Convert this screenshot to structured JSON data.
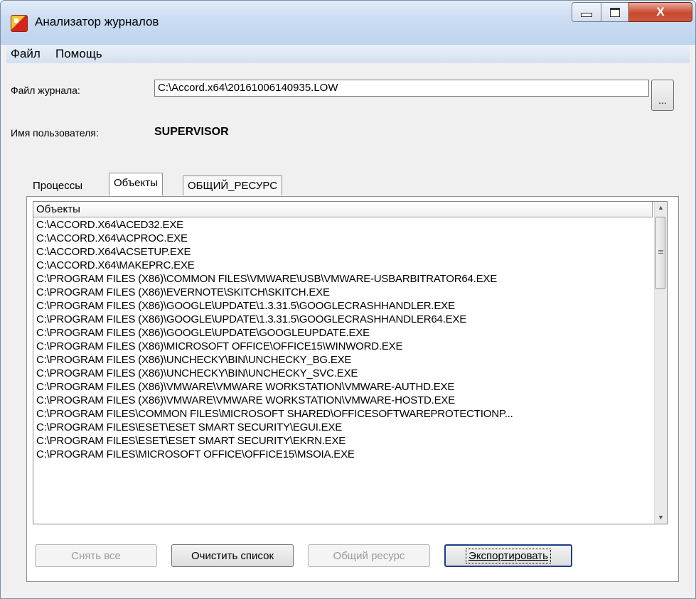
{
  "window": {
    "title": "Анализатор журналов",
    "close_glyph": "X"
  },
  "menu": {
    "items": [
      "Файл",
      "Помощь"
    ]
  },
  "form": {
    "log_file_label": "Файл журнала:",
    "log_file_value": "C:\\Accord.x64\\20161006140935.LOW",
    "browse_label": "...",
    "user_label": "Имя пользователя:",
    "user_value": "SUPERVISOR"
  },
  "tabs": [
    "Процессы",
    "Объекты",
    "ОБЩИЙ_РЕСУРС"
  ],
  "active_tab": "Объекты",
  "list": {
    "column_header": "Объекты",
    "rows": [
      "C:\\ACCORD.X64\\ACED32.EXE",
      "C:\\ACCORD.X64\\ACPROC.EXE",
      "C:\\ACCORD.X64\\ACSETUP.EXE",
      "C:\\ACCORD.X64\\MAKEPRC.EXE",
      "C:\\PROGRAM FILES (X86)\\COMMON FILES\\VMWARE\\USB\\VMWARE-USBARBITRATOR64.EXE",
      "C:\\PROGRAM FILES (X86)\\EVERNOTE\\SKITCH\\SKITCH.EXE",
      "C:\\PROGRAM FILES (X86)\\GOOGLE\\UPDATE\\1.3.31.5\\GOOGLECRASHHANDLER.EXE",
      "C:\\PROGRAM FILES (X86)\\GOOGLE\\UPDATE\\1.3.31.5\\GOOGLECRASHHANDLER64.EXE",
      "C:\\PROGRAM FILES (X86)\\GOOGLE\\UPDATE\\GOOGLEUPDATE.EXE",
      "C:\\PROGRAM FILES (X86)\\MICROSOFT OFFICE\\OFFICE15\\WINWORD.EXE",
      "C:\\PROGRAM FILES (X86)\\UNCHECKY\\BIN\\UNCHECKY_BG.EXE",
      "C:\\PROGRAM FILES (X86)\\UNCHECKY\\BIN\\UNCHECKY_SVC.EXE",
      "C:\\PROGRAM FILES (X86)\\VMWARE\\VMWARE WORKSTATION\\VMWARE-AUTHD.EXE",
      "C:\\PROGRAM FILES (X86)\\VMWARE\\VMWARE WORKSTATION\\VMWARE-HOSTD.EXE",
      "C:\\PROGRAM FILES\\COMMON FILES\\MICROSOFT SHARED\\OFFICESOFTWAREPROTECTIONP...",
      "C:\\PROGRAM FILES\\ESET\\ESET SMART SECURITY\\EGUI.EXE",
      "C:\\PROGRAM FILES\\ESET\\ESET SMART SECURITY\\EKRN.EXE",
      "C:\\PROGRAM FILES\\MICROSOFT OFFICE\\OFFICE15\\MSOIA.EXE"
    ]
  },
  "buttons": {
    "clear_all": "Снять все",
    "clear_list": "Очистить список",
    "shared_resource": "Общий ресурс",
    "export": "Экспортировать"
  }
}
